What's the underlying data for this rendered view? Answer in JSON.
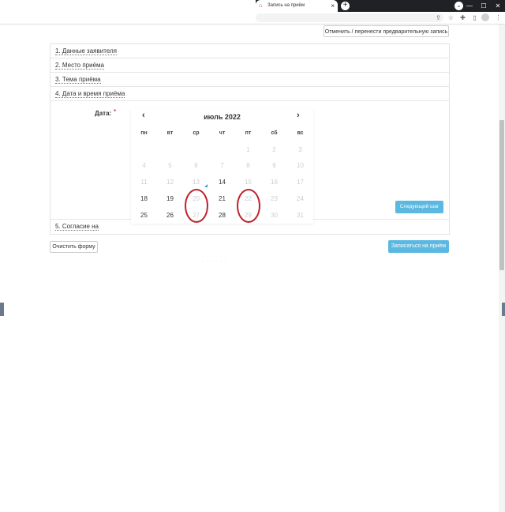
{
  "browser": {
    "tab_title": "Запись на приём",
    "close_glyph": "×",
    "new_tab_glyph": "+",
    "minimize_glyph": "—",
    "maximize_glyph": "☐",
    "window_close_glyph": "✕",
    "dropdown_glyph": "⌄",
    "icons": [
      "share-icon",
      "bookmark-star-icon",
      "extensions-icon",
      "sidebar-icon",
      "profile-avatar",
      "menu-icon"
    ]
  },
  "page": {
    "cancel_button": "Отменить / перенести предварительную запись",
    "steps": [
      "1. Данные заявителя",
      "2. Место приёма",
      "3. Тема приёма",
      "4. Дата и время приёма",
      "5. Согласие на"
    ],
    "date_label": "Дата:",
    "required_mark": "*",
    "next_step_button": "Следующий шаг",
    "clear_form_button": "Очистить форму",
    "submit_button": "Записаться на приём",
    "dots": "· · · · · ·"
  },
  "calendar": {
    "title": "июль 2022",
    "prev": "‹",
    "next": "›",
    "weekdays": [
      "пн",
      "вт",
      "ср",
      "чт",
      "пт",
      "сб",
      "вс"
    ],
    "weeks": [
      [
        "",
        "",
        "",
        "",
        "1",
        "2",
        "3"
      ],
      [
        "4",
        "5",
        "6",
        "7",
        "8",
        "9",
        "10"
      ],
      [
        "11",
        "12",
        "13",
        "14",
        "15",
        "16",
        "17"
      ],
      [
        "18",
        "19",
        "20",
        "21",
        "22",
        "23",
        "24"
      ],
      [
        "25",
        "26",
        "27",
        "28",
        "29",
        "30",
        "31"
      ]
    ],
    "enabled_days": [
      "14",
      "18",
      "19",
      "21",
      "25",
      "26",
      "28"
    ],
    "circled_days": [
      "27",
      "29"
    ],
    "circle_color": "#c0202a",
    "accent_color": "#5bb8e0"
  }
}
